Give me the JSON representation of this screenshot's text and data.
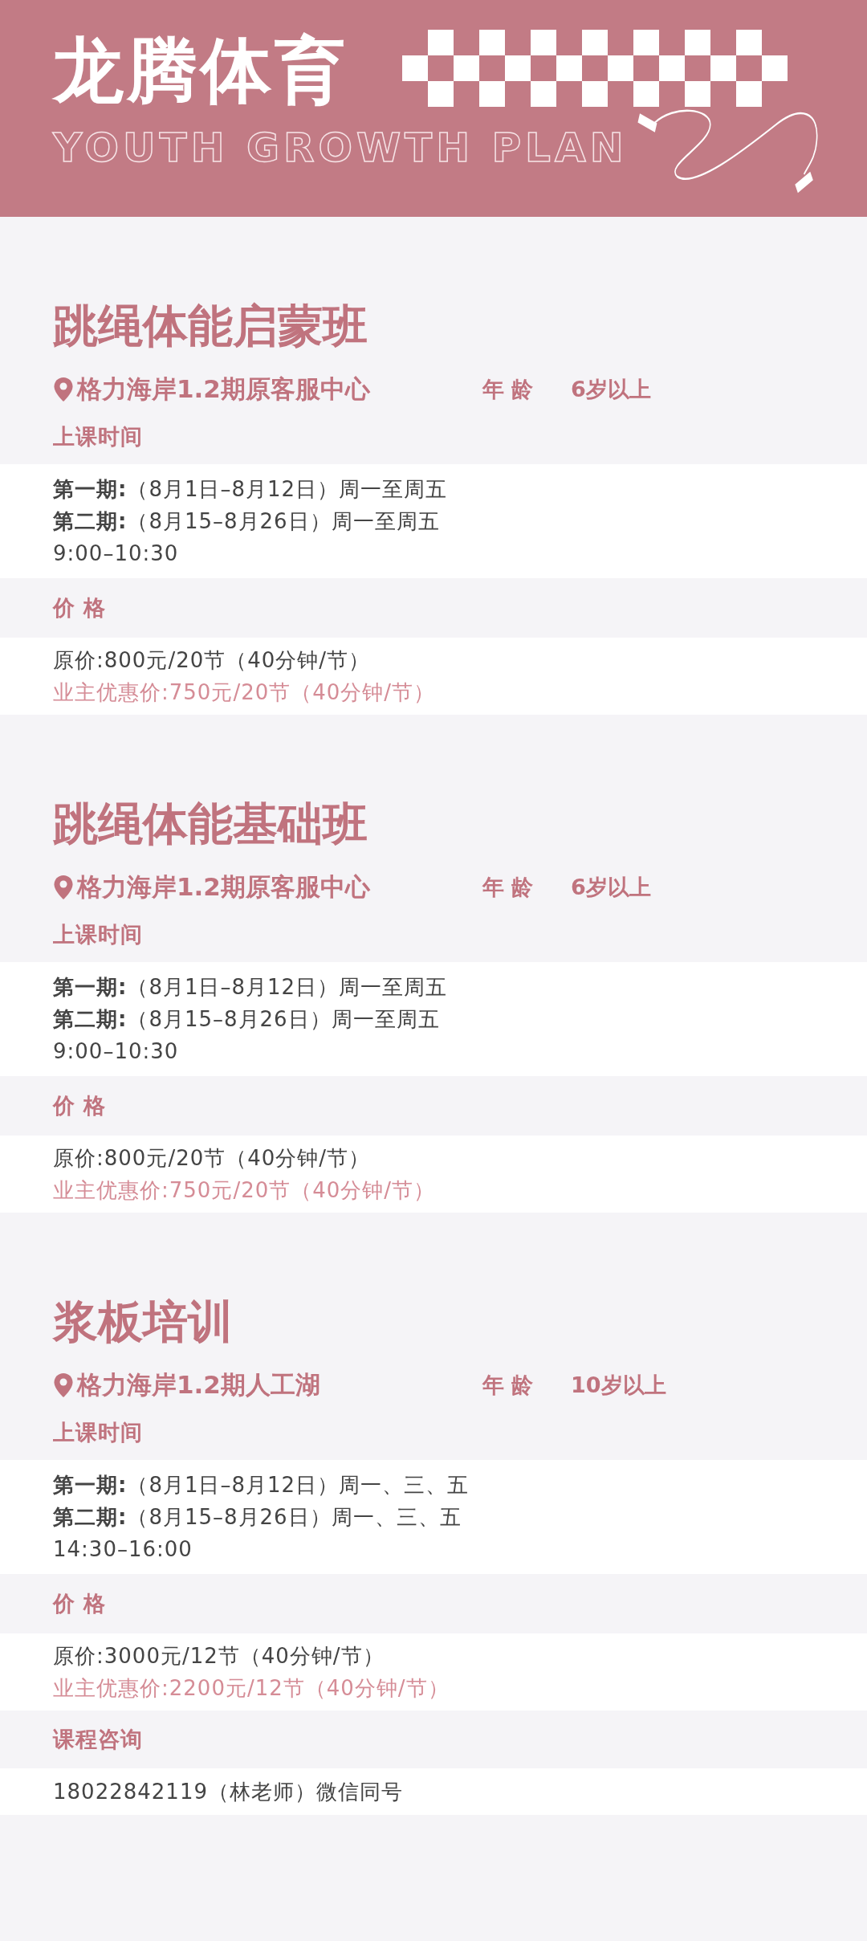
{
  "header": {
    "title": "龙腾体育",
    "subtitle": "YOUTH GROWTH PLAN"
  },
  "courses": [
    {
      "title": "跳绳体能启蒙班",
      "location": "格力海岸1.2期原客服中心",
      "age_label": "年 龄",
      "age": "6岁以上",
      "schedule_label": "上课时间",
      "schedule": [
        "**第一期:**（8月1日–8月12日）周一至周五",
        "**第二期:**（8月15–8月26日）周一至周五",
        "9:00–10:30"
      ],
      "price_label": "价 格",
      "prices": [
        {
          "kind": "regular",
          "text": "原价:800元/20节（40分钟/节）"
        },
        {
          "kind": "member",
          "text": "业主优惠价:750元/20节（40分钟/节）"
        }
      ]
    },
    {
      "title": "跳绳体能基础班",
      "location": "格力海岸1.2期原客服中心",
      "age_label": "年 龄",
      "age": "6岁以上",
      "schedule_label": "上课时间",
      "schedule": [
        "**第一期:**（8月1日–8月12日）周一至周五",
        "**第二期:**（8月15–8月26日）周一至周五",
        "9:00–10:30"
      ],
      "price_label": "价 格",
      "prices": [
        {
          "kind": "regular",
          "text": "原价:800元/20节（40分钟/节）"
        },
        {
          "kind": "member",
          "text": "业主优惠价:750元/20节（40分钟/节）"
        }
      ]
    },
    {
      "title": "浆板培训",
      "location": "格力海岸1.2期人工湖",
      "age_label": "年 龄",
      "age": "10岁以上",
      "schedule_label": "上课时间",
      "schedule": [
        "**第一期:**（8月1日–8月12日）周一、三、五",
        "**第二期:**（8月15–8月26日）周一、三、五",
        "14:30–16:00"
      ],
      "price_label": "价 格",
      "prices": [
        {
          "kind": "regular",
          "text": "原价:3000元/12节（40分钟/节）"
        },
        {
          "kind": "member",
          "text": "业主优惠价:2200元/12节（40分钟/节）"
        }
      ]
    }
  ],
  "consult": {
    "label": "课程咨询",
    "text": "18022842119（林老师）微信同号"
  }
}
